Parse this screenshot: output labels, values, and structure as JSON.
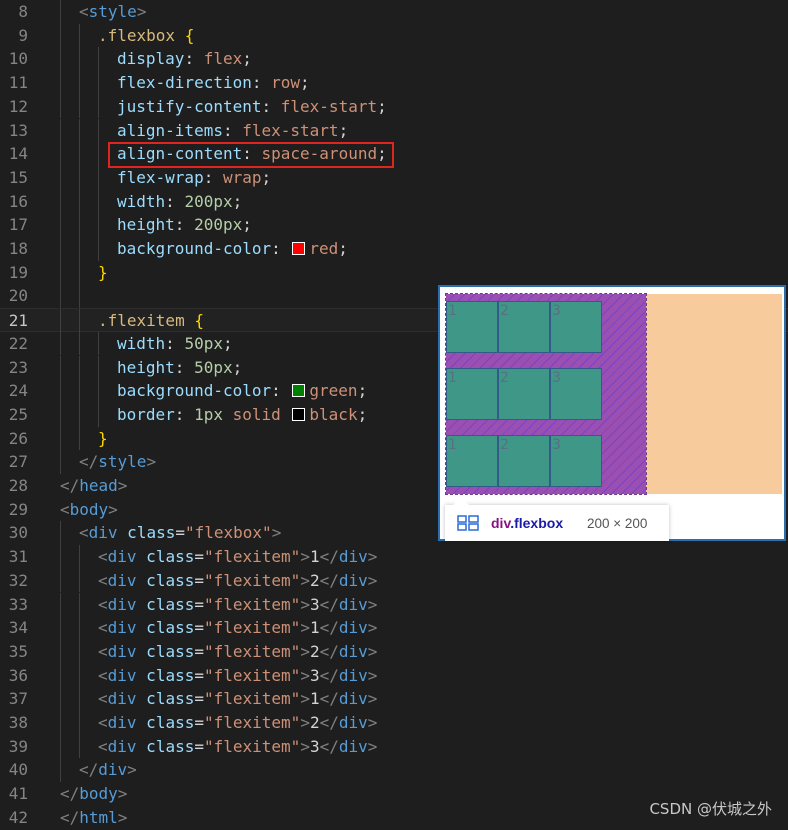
{
  "editor": {
    "lines": [
      {
        "n": "8",
        "tokens": [
          [
            "punc",
            "<"
          ],
          [
            "tag",
            "style"
          ],
          [
            "punc",
            ">"
          ]
        ]
      },
      {
        "n": "9",
        "tokens": [
          [
            "sel",
            ".flexbox "
          ],
          [
            "brace",
            "{"
          ]
        ]
      },
      {
        "n": "10",
        "tokens": [
          [
            "prop",
            "display"
          ],
          [
            "text",
            ": "
          ],
          [
            "val",
            "flex"
          ],
          [
            "text",
            ";"
          ]
        ]
      },
      {
        "n": "11",
        "tokens": [
          [
            "prop",
            "flex-direction"
          ],
          [
            "text",
            ": "
          ],
          [
            "val",
            "row"
          ],
          [
            "text",
            ";"
          ]
        ]
      },
      {
        "n": "12",
        "tokens": [
          [
            "prop",
            "justify-content"
          ],
          [
            "text",
            ": "
          ],
          [
            "val",
            "flex-start"
          ],
          [
            "text",
            ";"
          ]
        ]
      },
      {
        "n": "13",
        "tokens": [
          [
            "prop",
            "align-items"
          ],
          [
            "text",
            ": "
          ],
          [
            "val",
            "flex-start"
          ],
          [
            "text",
            ";"
          ]
        ]
      },
      {
        "n": "14",
        "tokens": [
          [
            "prop",
            "align-content"
          ],
          [
            "text",
            ": "
          ],
          [
            "val",
            "space-around"
          ],
          [
            "text",
            ";"
          ]
        ]
      },
      {
        "n": "15",
        "tokens": [
          [
            "prop",
            "flex-wrap"
          ],
          [
            "text",
            ": "
          ],
          [
            "val",
            "wrap"
          ],
          [
            "text",
            ";"
          ]
        ]
      },
      {
        "n": "16",
        "tokens": [
          [
            "prop",
            "width"
          ],
          [
            "text",
            ": "
          ],
          [
            "num",
            "200px"
          ],
          [
            "text",
            ";"
          ]
        ]
      },
      {
        "n": "17",
        "tokens": [
          [
            "prop",
            "height"
          ],
          [
            "text",
            ": "
          ],
          [
            "num",
            "200px"
          ],
          [
            "text",
            ";"
          ]
        ]
      },
      {
        "n": "18",
        "tokens": [
          [
            "prop",
            "background-color"
          ],
          [
            "text",
            ": "
          ],
          [
            "swatch",
            "#ff0000"
          ],
          [
            "val",
            "red"
          ],
          [
            "text",
            ";"
          ]
        ]
      },
      {
        "n": "19",
        "tokens": [
          [
            "brace",
            "}"
          ]
        ]
      },
      {
        "n": "20",
        "tokens": []
      },
      {
        "n": "21",
        "tokens": [
          [
            "sel",
            ".flexitem "
          ],
          [
            "brace",
            "{"
          ]
        ]
      },
      {
        "n": "22",
        "tokens": [
          [
            "prop",
            "width"
          ],
          [
            "text",
            ": "
          ],
          [
            "num",
            "50px"
          ],
          [
            "text",
            ";"
          ]
        ]
      },
      {
        "n": "23",
        "tokens": [
          [
            "prop",
            "height"
          ],
          [
            "text",
            ": "
          ],
          [
            "num",
            "50px"
          ],
          [
            "text",
            ";"
          ]
        ]
      },
      {
        "n": "24",
        "tokens": [
          [
            "prop",
            "background-color"
          ],
          [
            "text",
            ": "
          ],
          [
            "swatch",
            "#008000"
          ],
          [
            "val",
            "green"
          ],
          [
            "text",
            ";"
          ]
        ]
      },
      {
        "n": "25",
        "tokens": [
          [
            "prop",
            "border"
          ],
          [
            "text",
            ": "
          ],
          [
            "num",
            "1px"
          ],
          [
            "val",
            " solid "
          ],
          [
            "swatch",
            "#000000"
          ],
          [
            "val",
            "black"
          ],
          [
            "text",
            ";"
          ]
        ]
      },
      {
        "n": "26",
        "tokens": [
          [
            "brace",
            "}"
          ]
        ]
      },
      {
        "n": "27",
        "tokens": [
          [
            "punc",
            "</"
          ],
          [
            "tag",
            "style"
          ],
          [
            "punc",
            ">"
          ]
        ]
      },
      {
        "n": "28",
        "tokens": [
          [
            "punc",
            "</"
          ],
          [
            "tag",
            "head"
          ],
          [
            "punc",
            ">"
          ]
        ]
      },
      {
        "n": "29",
        "tokens": [
          [
            "punc",
            "<"
          ],
          [
            "tag",
            "body"
          ],
          [
            "punc",
            ">"
          ]
        ]
      },
      {
        "n": "30",
        "tokens": [
          [
            "punc",
            "<"
          ],
          [
            "tag",
            "div"
          ],
          [
            "attr",
            " class"
          ],
          [
            "text",
            "="
          ],
          [
            "str",
            "\"flexbox\""
          ],
          [
            "punc",
            ">"
          ]
        ]
      },
      {
        "n": "31",
        "tokens": [
          [
            "punc",
            "<"
          ],
          [
            "tag",
            "div"
          ],
          [
            "attr",
            " class"
          ],
          [
            "text",
            "="
          ],
          [
            "str",
            "\"flexitem\""
          ],
          [
            "punc",
            ">"
          ],
          [
            "text",
            "1"
          ],
          [
            "punc",
            "</"
          ],
          [
            "tag",
            "div"
          ],
          [
            "punc",
            ">"
          ]
        ]
      },
      {
        "n": "32",
        "tokens": [
          [
            "punc",
            "<"
          ],
          [
            "tag",
            "div"
          ],
          [
            "attr",
            " class"
          ],
          [
            "text",
            "="
          ],
          [
            "str",
            "\"flexitem\""
          ],
          [
            "punc",
            ">"
          ],
          [
            "text",
            "2"
          ],
          [
            "punc",
            "</"
          ],
          [
            "tag",
            "div"
          ],
          [
            "punc",
            ">"
          ]
        ]
      },
      {
        "n": "33",
        "tokens": [
          [
            "punc",
            "<"
          ],
          [
            "tag",
            "div"
          ],
          [
            "attr",
            " class"
          ],
          [
            "text",
            "="
          ],
          [
            "str",
            "\"flexitem\""
          ],
          [
            "punc",
            ">"
          ],
          [
            "text",
            "3"
          ],
          [
            "punc",
            "</"
          ],
          [
            "tag",
            "div"
          ],
          [
            "punc",
            ">"
          ]
        ]
      },
      {
        "n": "34",
        "tokens": [
          [
            "punc",
            "<"
          ],
          [
            "tag",
            "div"
          ],
          [
            "attr",
            " class"
          ],
          [
            "text",
            "="
          ],
          [
            "str",
            "\"flexitem\""
          ],
          [
            "punc",
            ">"
          ],
          [
            "text",
            "1"
          ],
          [
            "punc",
            "</"
          ],
          [
            "tag",
            "div"
          ],
          [
            "punc",
            ">"
          ]
        ]
      },
      {
        "n": "35",
        "tokens": [
          [
            "punc",
            "<"
          ],
          [
            "tag",
            "div"
          ],
          [
            "attr",
            " class"
          ],
          [
            "text",
            "="
          ],
          [
            "str",
            "\"flexitem\""
          ],
          [
            "punc",
            ">"
          ],
          [
            "text",
            "2"
          ],
          [
            "punc",
            "</"
          ],
          [
            "tag",
            "div"
          ],
          [
            "punc",
            ">"
          ]
        ]
      },
      {
        "n": "36",
        "tokens": [
          [
            "punc",
            "<"
          ],
          [
            "tag",
            "div"
          ],
          [
            "attr",
            " class"
          ],
          [
            "text",
            "="
          ],
          [
            "str",
            "\"flexitem\""
          ],
          [
            "punc",
            ">"
          ],
          [
            "text",
            "3"
          ],
          [
            "punc",
            "</"
          ],
          [
            "tag",
            "div"
          ],
          [
            "punc",
            ">"
          ]
        ]
      },
      {
        "n": "37",
        "tokens": [
          [
            "punc",
            "<"
          ],
          [
            "tag",
            "div"
          ],
          [
            "attr",
            " class"
          ],
          [
            "text",
            "="
          ],
          [
            "str",
            "\"flexitem\""
          ],
          [
            "punc",
            ">"
          ],
          [
            "text",
            "1"
          ],
          [
            "punc",
            "</"
          ],
          [
            "tag",
            "div"
          ],
          [
            "punc",
            ">"
          ]
        ]
      },
      {
        "n": "38",
        "tokens": [
          [
            "punc",
            "<"
          ],
          [
            "tag",
            "div"
          ],
          [
            "attr",
            " class"
          ],
          [
            "text",
            "="
          ],
          [
            "str",
            "\"flexitem\""
          ],
          [
            "punc",
            ">"
          ],
          [
            "text",
            "2"
          ],
          [
            "punc",
            "</"
          ],
          [
            "tag",
            "div"
          ],
          [
            "punc",
            ">"
          ]
        ]
      },
      {
        "n": "39",
        "tokens": [
          [
            "punc",
            "<"
          ],
          [
            "tag",
            "div"
          ],
          [
            "attr",
            " class"
          ],
          [
            "text",
            "="
          ],
          [
            "str",
            "\"flexitem\""
          ],
          [
            "punc",
            ">"
          ],
          [
            "text",
            "3"
          ],
          [
            "punc",
            "</"
          ],
          [
            "tag",
            "div"
          ],
          [
            "punc",
            ">"
          ]
        ]
      },
      {
        "n": "40",
        "tokens": [
          [
            "punc",
            "</"
          ],
          [
            "tag",
            "div"
          ],
          [
            "punc",
            ">"
          ]
        ]
      },
      {
        "n": "41",
        "tokens": [
          [
            "punc",
            "</"
          ],
          [
            "tag",
            "body"
          ],
          [
            "punc",
            ">"
          ]
        ]
      },
      {
        "n": "42",
        "tokens": [
          [
            "punc",
            "</"
          ],
          [
            "tag",
            "html"
          ],
          [
            "punc",
            ">"
          ]
        ]
      }
    ],
    "active_line": "21",
    "highlighted_line": "14"
  },
  "preview": {
    "rows": [
      [
        "1",
        "2",
        "3"
      ],
      [
        "1",
        "2",
        "3"
      ],
      [
        "1",
        "2",
        "3"
      ]
    ],
    "tooltip": {
      "tag": "div",
      "class_name": ".flexbox",
      "size": "200 × 200",
      "icon": "flex-layout-icon"
    }
  },
  "watermark": "CSDN @伏城之外",
  "colors": {
    "red_swatch": "#ff0000",
    "green_swatch": "#008000",
    "black_swatch": "#000000",
    "highlight_border": "#e0241f"
  }
}
